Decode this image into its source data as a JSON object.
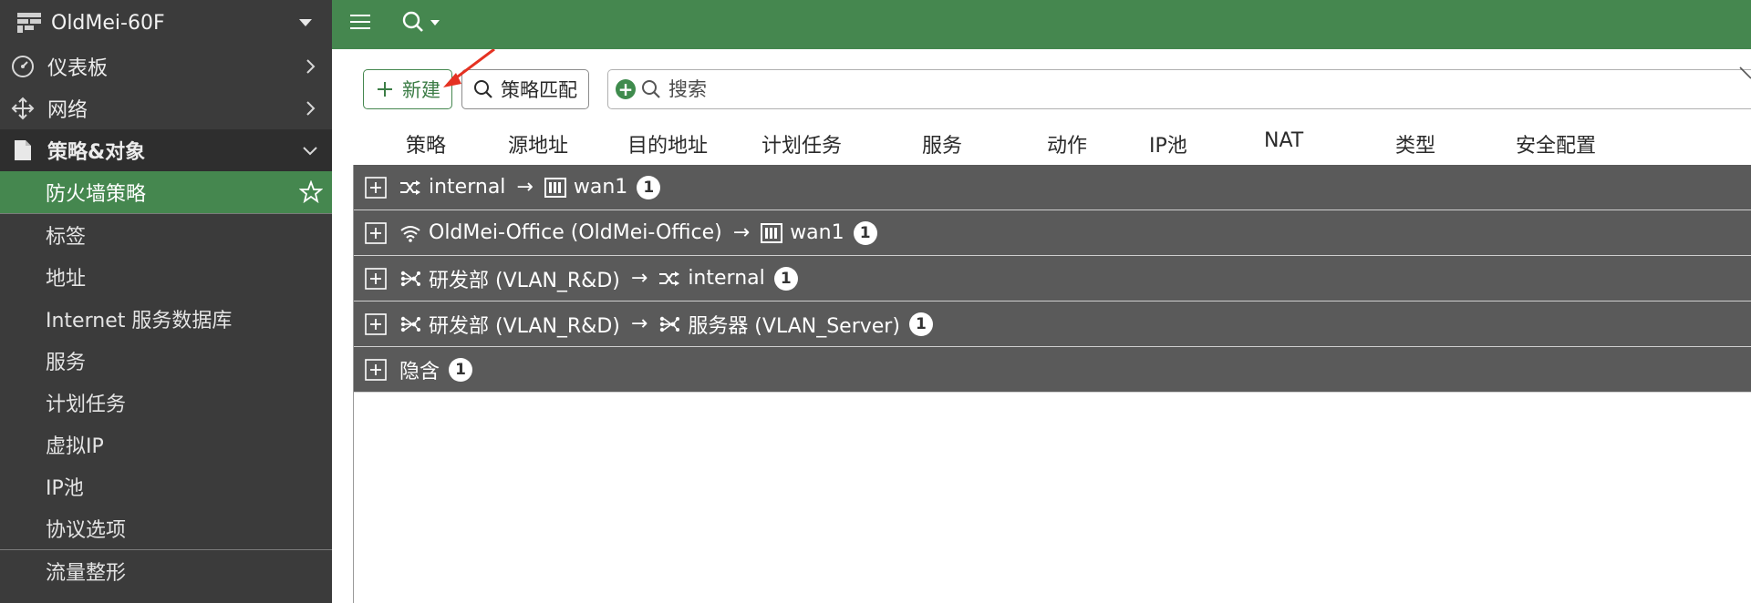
{
  "device": {
    "name": "OldMei-60F"
  },
  "nav": {
    "dashboard": "仪表板",
    "network": "网络",
    "policy_objects": "策略&对象",
    "sub_items": [
      {
        "label": "防火墙策略",
        "active": true
      },
      {
        "label": "标签"
      },
      {
        "label": "地址"
      },
      {
        "label": "Internet 服务数据库"
      },
      {
        "label": "服务"
      },
      {
        "label": "计划任务"
      },
      {
        "label": "虚拟IP"
      },
      {
        "label": "IP池"
      },
      {
        "label": "协议选项"
      },
      {
        "label": "流量整形"
      }
    ]
  },
  "toolbar": {
    "new_label": "新建",
    "policy_match_label": "策略匹配",
    "search_placeholder": "搜索"
  },
  "columns": [
    "策略",
    "源地址",
    "目的地址",
    "计划任务",
    "服务",
    "动作",
    "IP池",
    "NAT",
    "类型",
    "安全配置"
  ],
  "groups": [
    {
      "src": "internal",
      "src_icon": "interface-icon",
      "dst": "wan1",
      "dst_icon": "wan-port-icon",
      "count": "1"
    },
    {
      "src": "OldMei-Office (OldMei-Office)",
      "src_icon": "wifi-icon",
      "dst": "wan1",
      "dst_icon": "wan-port-icon",
      "count": "1"
    },
    {
      "src": "研发部 (VLAN_R&D)",
      "src_icon": "vlan-icon",
      "dst": "internal",
      "dst_icon": "interface-icon",
      "count": "1"
    },
    {
      "src": "研发部 (VLAN_R&D)",
      "src_icon": "vlan-icon",
      "dst": "服务器 (VLAN_Server)",
      "dst_icon": "vlan-icon",
      "count": "1"
    },
    {
      "src": "隐含",
      "count": "1"
    }
  ],
  "arrow_glyph": "→",
  "colors": {
    "brand_green": "#45874f",
    "sidebar_bg": "#3b3b3b",
    "group_bg": "#5a5a5a",
    "annotation_red": "#e53222"
  }
}
